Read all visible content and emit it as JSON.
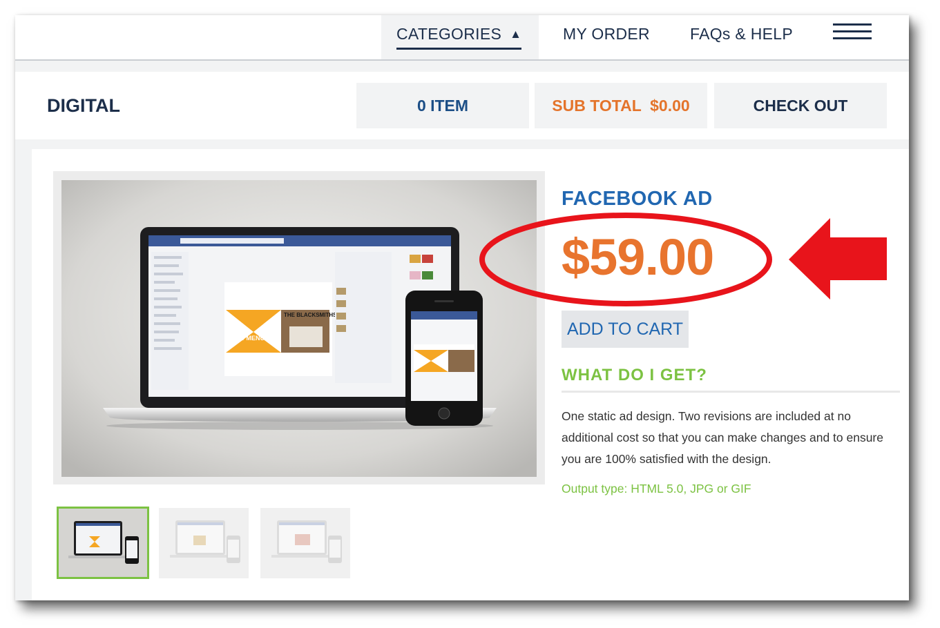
{
  "nav": {
    "categories": "CATEGORIES",
    "categories_arrow": "▲",
    "my_order": "MY ORDER",
    "faqs_help": "FAQs & HELP",
    "menu_icon": "hamburger-menu-icon"
  },
  "cart": {
    "section_title": "DIGITAL",
    "items": "0 ITEM",
    "subtotal": "SUB TOTAL  $0.00",
    "checkout": "CHECK OUT"
  },
  "product": {
    "title": "FACEBOOK AD",
    "price": "$59.00",
    "add_to_cart": "ADD TO CART",
    "what_heading": "WHAT DO I GET?",
    "description": "One static ad design. Two revisions are included at no additional cost so that you can make changes and to ensure you are 100% satisfied with the design.",
    "output_type": "Output type: HTML 5.0, JPG or GIF",
    "mockup_headline": "THE BLACKSMITHS",
    "mockup_subtext": "NEW MENUS"
  },
  "colors": {
    "navy": "#1c2e4a",
    "blue": "#2167b1",
    "orange": "#e8742e",
    "green": "#7cc242",
    "annotation_red": "#e8141b"
  }
}
